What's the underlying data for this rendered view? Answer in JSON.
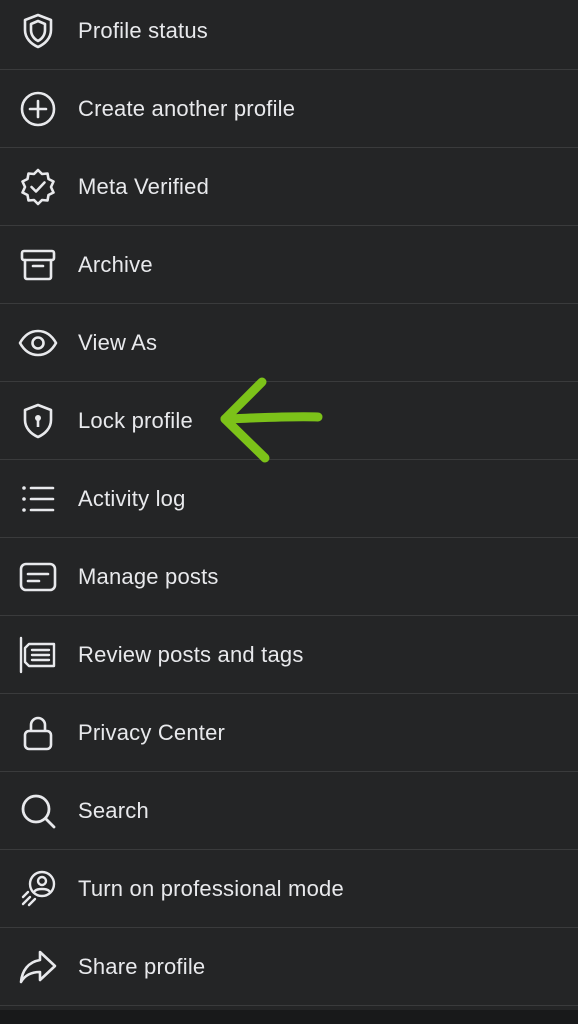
{
  "menu": {
    "items": [
      {
        "label": "Profile status",
        "icon": "shield-icon"
      },
      {
        "label": "Create another profile",
        "icon": "plus-circle-icon"
      },
      {
        "label": "Meta Verified",
        "icon": "verified-badge-icon"
      },
      {
        "label": "Archive",
        "icon": "archive-box-icon"
      },
      {
        "label": "View As",
        "icon": "eye-icon"
      },
      {
        "label": "Lock profile",
        "icon": "shield-lock-icon"
      },
      {
        "label": "Activity log",
        "icon": "list-icon"
      },
      {
        "label": "Manage posts",
        "icon": "manage-posts-icon"
      },
      {
        "label": "Review posts and tags",
        "icon": "review-posts-icon"
      },
      {
        "label": "Privacy Center",
        "icon": "lock-icon"
      },
      {
        "label": "Search",
        "icon": "search-icon"
      },
      {
        "label": "Turn on professional mode",
        "icon": "professional-mode-icon"
      },
      {
        "label": "Share profile",
        "icon": "share-arrow-icon"
      }
    ]
  },
  "annotation": {
    "arrow_color": "#7cc219",
    "points_to": "Lock profile"
  },
  "colors": {
    "background": "#242526",
    "divider": "#3a3b3c",
    "text": "#e4e6eb",
    "bottom_bar": "#18191a"
  }
}
